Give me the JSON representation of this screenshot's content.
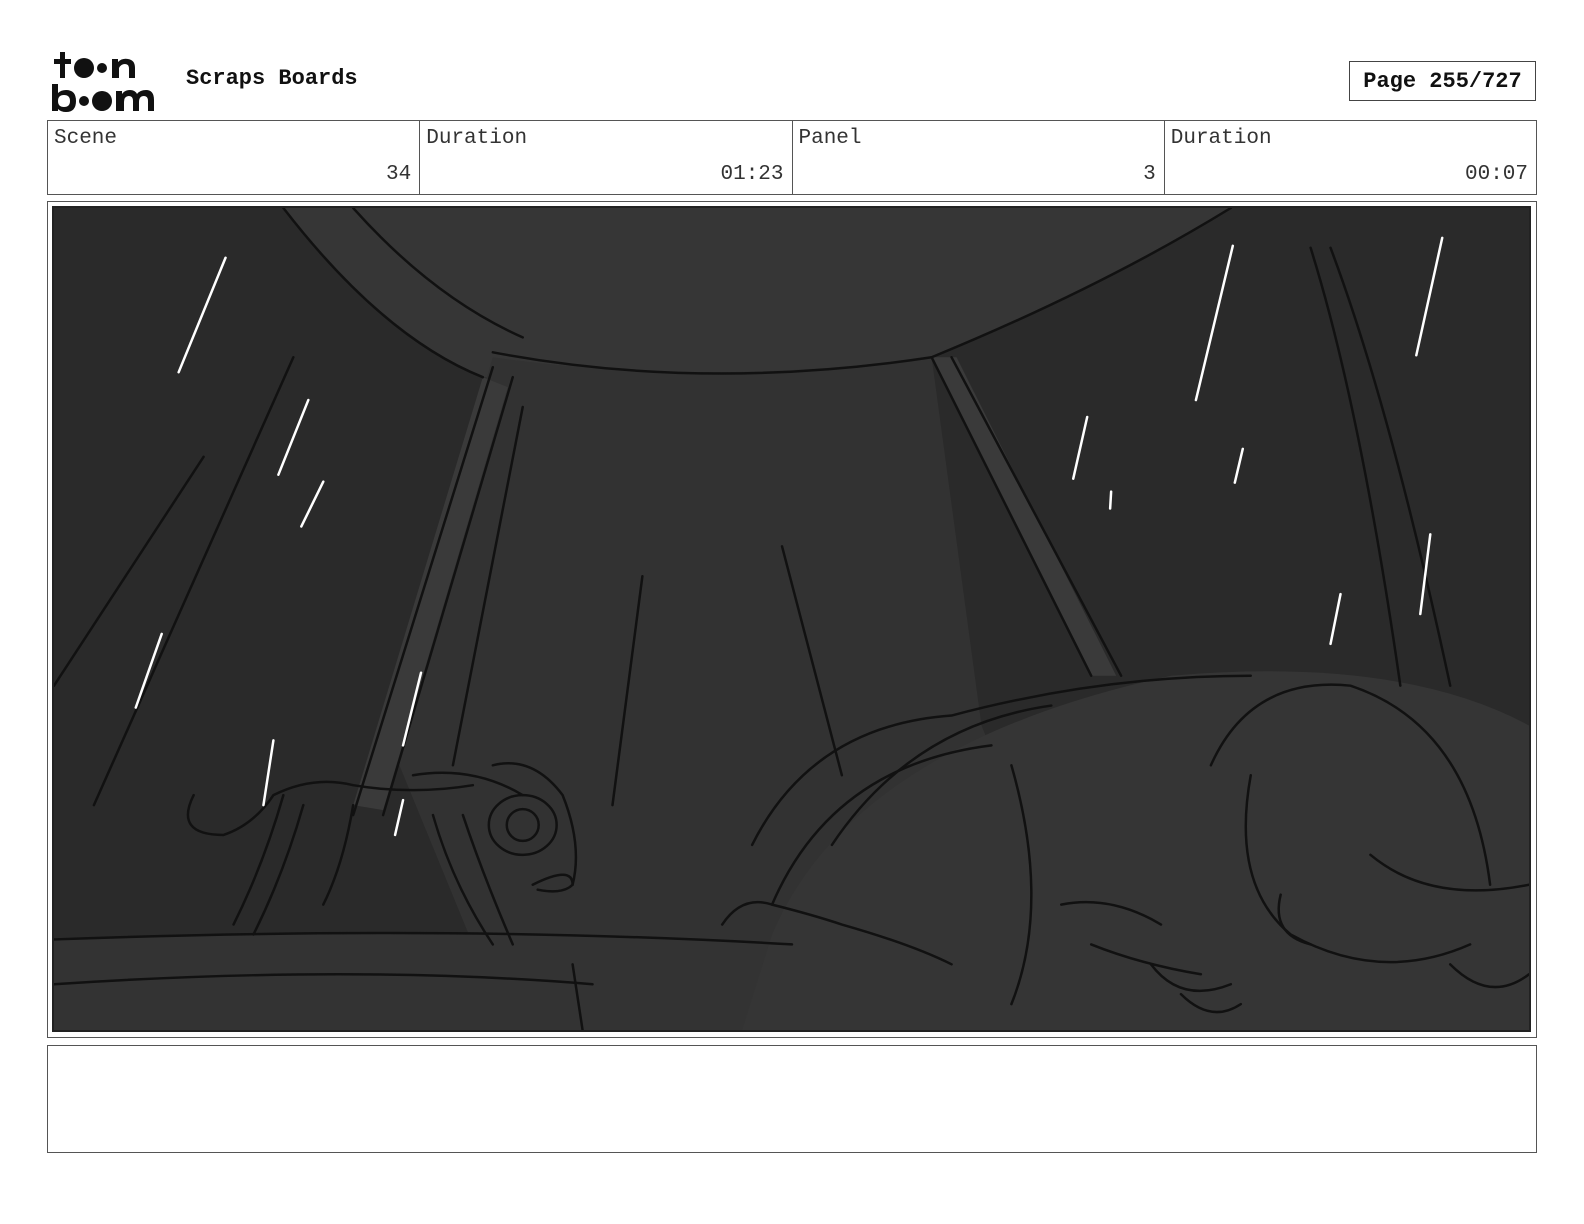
{
  "header": {
    "project_title": "Scraps Boards",
    "page_label": "Page 255/727"
  },
  "logo": {
    "icon": "toon-boom-logo",
    "text": "toon boom"
  },
  "info": {
    "scene_label": "Scene",
    "scene_value": "34",
    "scene_duration_label": "Duration",
    "scene_duration_value": "01:23",
    "panel_label": "Panel",
    "panel_value": "3",
    "panel_duration_label": "Duration",
    "panel_duration_value": "00:07"
  },
  "panel": {
    "icon": "storyboard-sketch-image",
    "colors": {
      "background": "#2b2b2b",
      "mid": "#353535",
      "line": "#111111",
      "rain": "#ffffff"
    }
  },
  "notes": {
    "text": ""
  }
}
